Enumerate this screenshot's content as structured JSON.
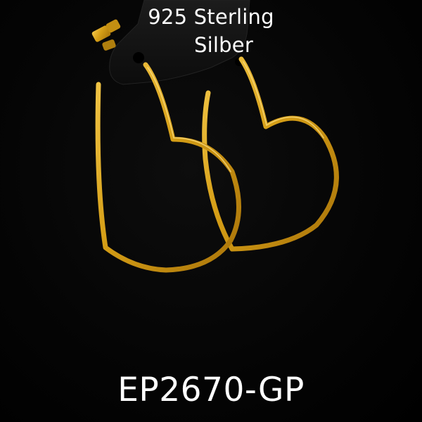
{
  "product": {
    "material_line_1": "925 Sterling",
    "material_line_2": "Silber",
    "sku": "EP2670-GP"
  },
  "colors": {
    "background": "#000000",
    "gold": "#d8a21a",
    "display_card": "#151515",
    "text": "#ffffff"
  }
}
